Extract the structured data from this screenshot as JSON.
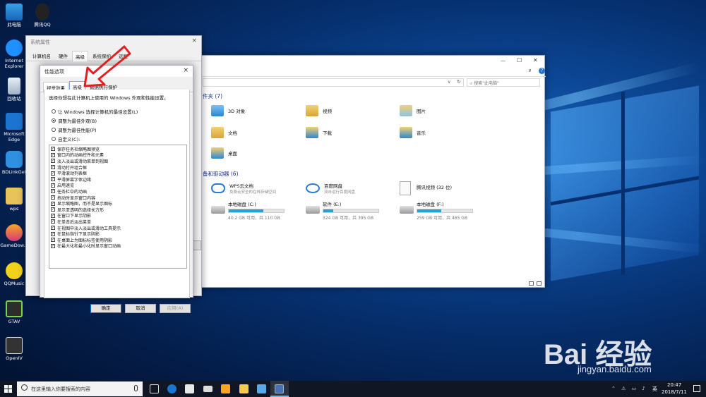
{
  "desktop": {
    "icons": [
      {
        "label": "此电脑"
      },
      {
        "label": "腾讯QQ"
      },
      {
        "label": "Internet Explorer"
      },
      {
        "label": "回收站"
      },
      {
        "label": "Microsoft Edge"
      },
      {
        "label": "BDLinkGet"
      },
      {
        "label": "wps"
      },
      {
        "label": "GameDow..."
      },
      {
        "label": "QQMusic"
      },
      {
        "label": "GTAV"
      },
      {
        "label": "OpenIV"
      }
    ]
  },
  "sysprops": {
    "title": "系统属性",
    "tabs": [
      "计算机名",
      "硬件",
      "高级",
      "系统保护",
      "远程"
    ],
    "active_tab": "高级"
  },
  "perf": {
    "title": "性能选项",
    "tabs": [
      "视觉效果",
      "高级",
      "数据执行保护"
    ],
    "description": "选择你想在此计算机上使用的 Windows 外观和性能设置。",
    "radios": [
      {
        "label": "让 Windows 选择计算机的最佳设置(L)",
        "selected": false
      },
      {
        "label": "调整为最佳外观(B)",
        "selected": true
      },
      {
        "label": "调整为最佳性能(P)",
        "selected": false
      },
      {
        "label": "自定义(C):",
        "selected": false
      }
    ],
    "checkboxes": [
      "保存任务栏缩略图预览",
      "窗口内的动画控件和元素",
      "淡入淡出或滑动菜单到视图",
      "滑动打开组合框",
      "平滑滚动列表框",
      "平滑屏幕字体边缘",
      "启用速览",
      "任务栏中的动画",
      "拖动时显示窗口内容",
      "显示缩略图，而不是显示图标",
      "显示亚透明的选择长方形",
      "在窗口下显示阴影",
      "在单击后淡出菜单",
      "在视图中淡入淡出或滑动工具提示",
      "在鼠标指针下显示阴影",
      "在桌面上为图标标签使用阴影",
      "在最大化和最小化时显示窗口动画"
    ],
    "check_mark": "✓",
    "buttons": {
      "ok": "确定",
      "cancel": "取消",
      "apply": "应用(A)"
    },
    "close": "×"
  },
  "explorer": {
    "controls": {
      "min": "—",
      "max": "☐",
      "close": "✕",
      "expand": "∨",
      "help": "?"
    },
    "search_placeholder": "搜索\"此电脑\"",
    "folders_header": "件夹 (7)",
    "folders": [
      "3D 对象",
      "视频",
      "图片",
      "文档",
      "下载",
      "音乐",
      "桌面"
    ],
    "devices_header": "备和驱动器 (6)",
    "devices": [
      {
        "name": "WPS云文档",
        "sub": "免费云安全的在线存储空间"
      },
      {
        "name": "百度网盘",
        "sub": "双击运行百度网盘"
      },
      {
        "name": "腾讯视频 (32 位)",
        "sub": ""
      }
    ],
    "drives": [
      {
        "name": "本地磁盘 (C:)",
        "free": "40.2 GB 可用，共 110 GB",
        "used_fraction": 0.63
      },
      {
        "name": "软件 (E:)",
        "free": "324 GB 可用，共 395 GB",
        "used_fraction": 0.18
      },
      {
        "name": "本地磁盘 (F:)",
        "free": "259 GB 可用，共 465 GB",
        "used_fraction": 0.44
      }
    ]
  },
  "taskbar": {
    "search_placeholder": "在这里输入你要搜索的内容",
    "clock_time": "20:47",
    "clock_date": "2018/7/11",
    "lang": "英"
  },
  "watermark": {
    "brand": "Bai 经验",
    "url": "jingyan.baidu.com"
  },
  "colors": {
    "accent": "#0078d7",
    "drive_fill": "#26a0da",
    "arrow": "#e02020"
  }
}
